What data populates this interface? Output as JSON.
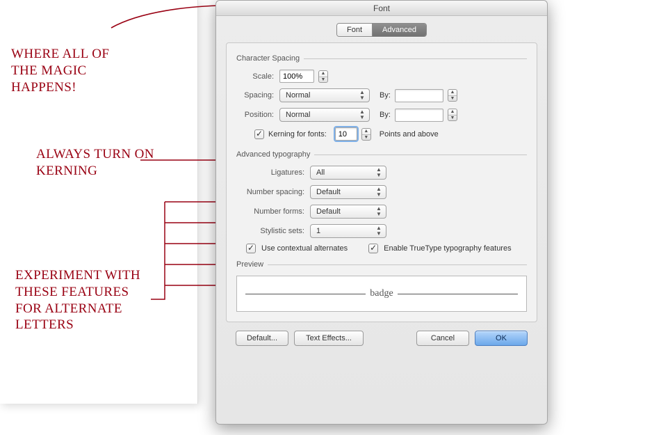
{
  "annotations": {
    "magic": "WHERE ALL OF THE MAGIC HAPPENS!",
    "kerning": "ALWAYS TURN ON KERNING",
    "experiment": "EXPERIMENT WITH THESE FEATURES FOR ALTERNATE LETTERS"
  },
  "dialog": {
    "title": "Font",
    "tabs": {
      "font": "Font",
      "advanced": "Advanced"
    },
    "groups": {
      "charspacing": "Character Spacing",
      "advtypo": "Advanced typography",
      "preview": "Preview"
    },
    "scale": {
      "label": "Scale:",
      "value": "100%"
    },
    "spacing": {
      "label": "Spacing:",
      "value": "Normal",
      "byLabel": "By:",
      "byValue": ""
    },
    "position": {
      "label": "Position:",
      "value": "Normal",
      "byLabel": "By:",
      "byValue": ""
    },
    "kerning": {
      "label": "Kerning for fonts:",
      "value": "10",
      "suffix": "Points and above",
      "checked": true
    },
    "ligatures": {
      "label": "Ligatures:",
      "value": "All"
    },
    "numspacing": {
      "label": "Number spacing:",
      "value": "Default"
    },
    "numforms": {
      "label": "Number forms:",
      "value": "Default"
    },
    "stylistic": {
      "label": "Stylistic sets:",
      "value": "1"
    },
    "contextual": {
      "label": "Use contextual alternates",
      "checked": true
    },
    "truetype": {
      "label": "Enable TrueType typography features",
      "checked": true
    },
    "preview_sample": "badge",
    "buttons": {
      "default": "Default...",
      "texteffects": "Text Effects...",
      "cancel": "Cancel",
      "ok": "OK"
    }
  }
}
